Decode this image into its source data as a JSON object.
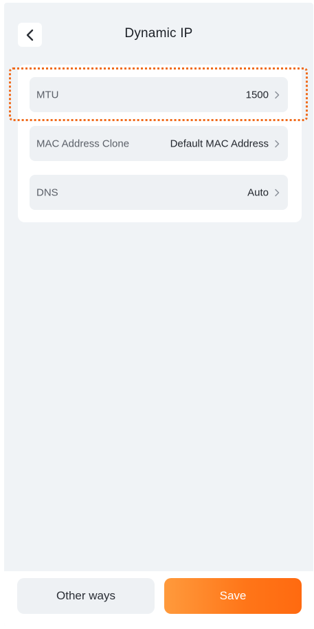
{
  "header": {
    "title": "Dynamic IP",
    "back_icon": "chevron-left-icon"
  },
  "settings": {
    "rows": [
      {
        "label": "MTU",
        "value": "1500"
      },
      {
        "label": "MAC Address Clone",
        "value": "Default MAC Address"
      },
      {
        "label": "DNS",
        "value": "Auto"
      }
    ]
  },
  "footer": {
    "other_label": "Other ways",
    "save_label": "Save"
  },
  "colors": {
    "background": "#f0f3f6",
    "accent": "#ff7518",
    "highlight": "#f06a1a"
  }
}
